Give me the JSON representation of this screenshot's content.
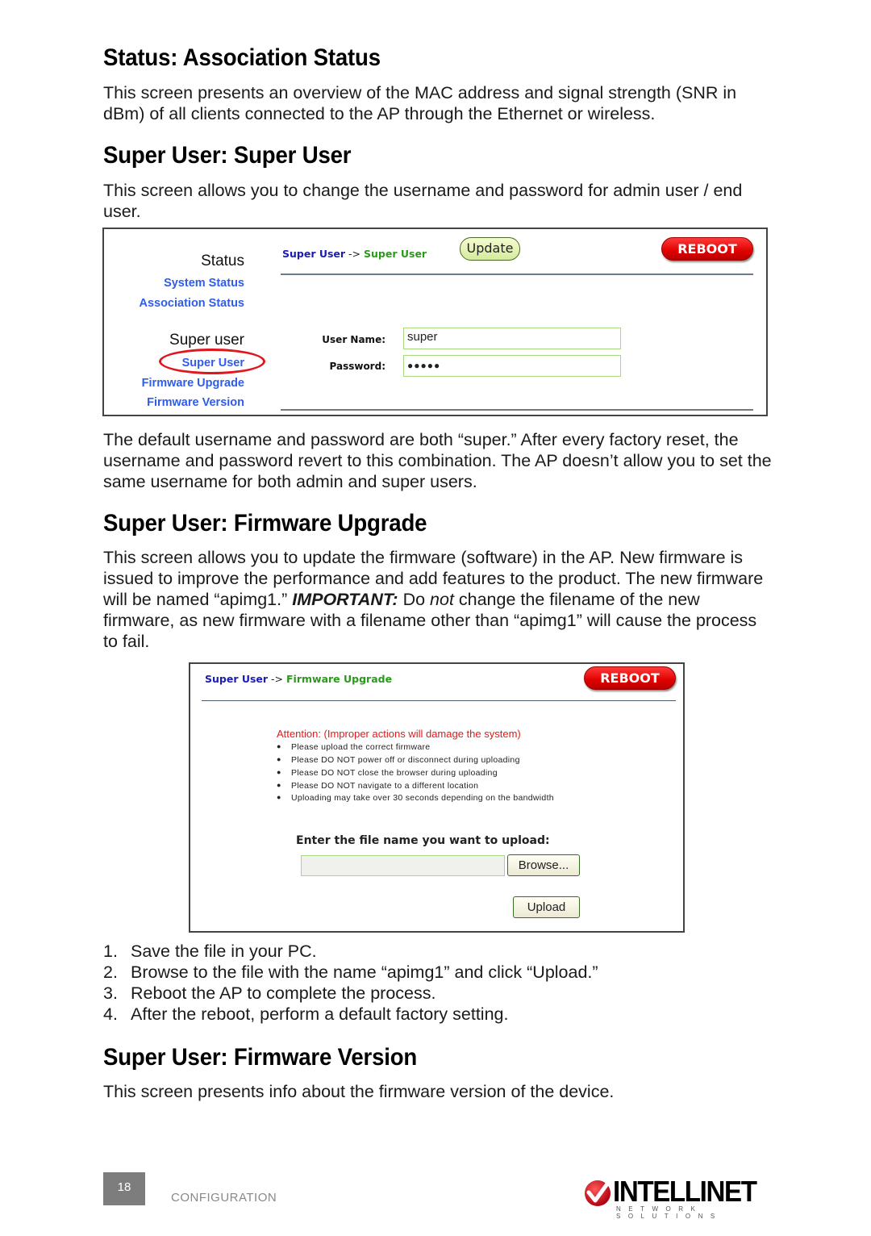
{
  "sections": [
    {
      "heading": "Status: Association Status",
      "body": "This screen presents an overview of the MAC address and signal strength (SNR in dBm) of all clients connected to the AP through the Ethernet or wireless."
    },
    {
      "heading": "Super User: Super User",
      "body": "This screen allows you to change the username and password for admin user / end user.",
      "after": "The default username and password are both “super.” After every factory reset, the username and password revert to this combination. The AP doesn’t allow you to set the same username for both admin and super users."
    },
    {
      "heading": "Super User: Firmware Upgrade",
      "body_pre": "This screen allows you to update the firmware (software) in the AP. New firmware is issued to improve the performance and add features to the product. The new firmware will be named “apimg1.” ",
      "body_important": "IMPORTANT:",
      "body_mid": " Do ",
      "body_not": "not",
      "body_post": " change the filename of the new firmware, as new firmware with a filename other than “apimg1” will cause the process to fail.",
      "steps": [
        "Save the file in your PC.",
        "Browse to the file with the name “apimg1” and click “Upload.”",
        "Reboot the AP to complete the process.",
        "After the reboot, perform a default factory setting."
      ],
      "step_numbers": [
        "1.",
        "2.",
        "3.",
        "4."
      ]
    },
    {
      "heading": "Super User: Firmware Version",
      "body": "This screen presents info about the firmware version of the device."
    }
  ],
  "screenshot1": {
    "sidebar": {
      "group1_title": "Status",
      "group1_items": [
        "System Status",
        "Association Status"
      ],
      "group2_title": "Super user",
      "group2_items": [
        "Super User",
        "Firmware Upgrade",
        "Firmware Version"
      ],
      "highlighted_item": "Super User"
    },
    "breadcrumb": {
      "parent": "Super User",
      "separator": " -> ",
      "current": "Super User"
    },
    "update_button": "Update",
    "reboot_button": "REBOOT",
    "form": {
      "username_label": "User Name:",
      "username_value": "super",
      "password_label": "Password:",
      "password_value": "●●●●●"
    }
  },
  "screenshot2": {
    "breadcrumb": {
      "parent": "Super User",
      "separator": " -> ",
      "current": "Firmware Upgrade"
    },
    "reboot_button": "REBOOT",
    "attention": "Attention: (Improper actions will damage the system)",
    "bullets": [
      "Please upload the correct firmware",
      "Please DO NOT power off or disconnect during uploading",
      "Please DO NOT close the browser during uploading",
      "Please DO NOT navigate to a different location",
      "Uploading may take over 30 seconds depending on the bandwidth"
    ],
    "file_prompt": "Enter the file name you want to upload:",
    "file_value": "",
    "browse_button": "Browse...",
    "upload_button": "Upload"
  },
  "footer": {
    "page_number": "18",
    "section_label": "CONFIGURATION",
    "logo_text": "INTELLINET",
    "logo_tagline": "NETWORK SOLUTIONS"
  },
  "colors": {
    "link_blue": "#2f5de8",
    "crumb_parent": "#1c1cb0",
    "crumb_current": "#2a9a1a",
    "reboot_red": "#e00000",
    "attention_red": "#e01a1a",
    "highlight_ellipse": "#e0161e"
  }
}
